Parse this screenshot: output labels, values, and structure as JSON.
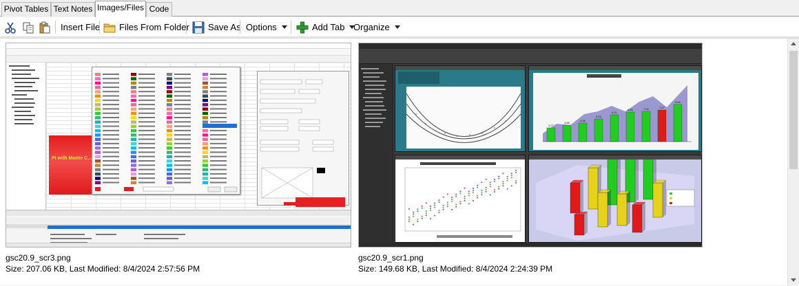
{
  "tabs": [
    {
      "label": "Pivot Tables",
      "active": false
    },
    {
      "label": "Text Notes",
      "active": false
    },
    {
      "label": "Images/Files",
      "active": true
    },
    {
      "label": "Code",
      "active": false
    }
  ],
  "toolbar": {
    "cut_icon": "scissors-icon",
    "copy_icon": "copy-icon",
    "paste_icon": "paste-icon",
    "insert_file": "Insert File",
    "files_from_folder": "Files From Folder",
    "save_as": "Save As",
    "options": "Options",
    "add_tab": "Add Tab",
    "organize": "Organize"
  },
  "files": [
    {
      "name": "gsc20.9_scr3.png",
      "info": "Size: 207.06 KB, Last Modified: 8/4/2024 2:57:56 PM"
    },
    {
      "name": "gsc20.9_scr1.png",
      "info": "Size: 149.68 KB, Last Modified: 8/4/2024 2:24:39 PM"
    }
  ],
  "preview1": {
    "banner": "Pi with Monte C..."
  },
  "preview2": {
    "chart_bar_labels": [
      "3.27",
      "3.89",
      "4.36",
      "5.34",
      "6.21",
      "6.86",
      "7.00",
      "7.27",
      "8.45"
    ]
  },
  "colors": {
    "accent_green": "#2e9e2e",
    "selection_blue": "#1f6fd1",
    "chart_red": "#e01a1a",
    "chart_green": "#22cc22",
    "chart_yellow": "#e6d21a"
  }
}
